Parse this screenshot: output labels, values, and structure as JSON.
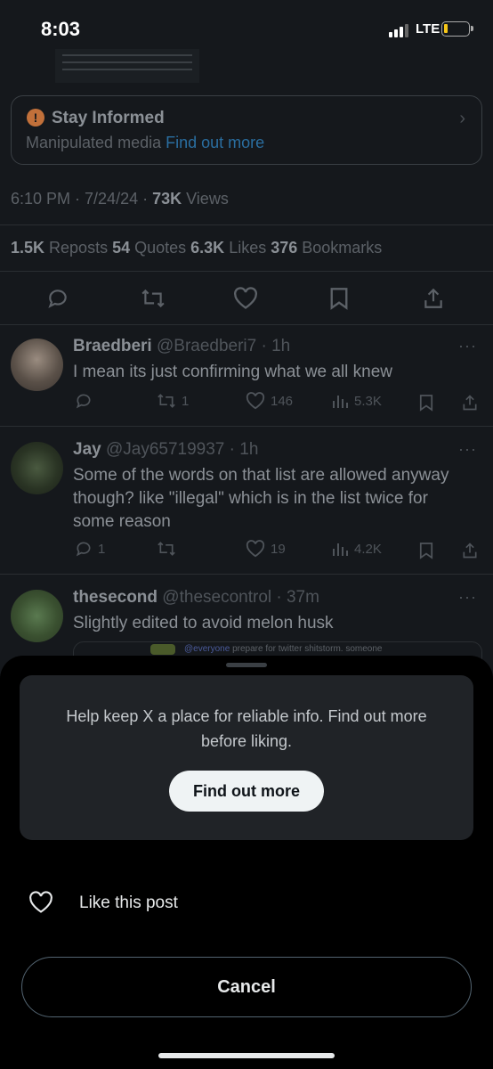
{
  "status_bar": {
    "time": "8:03",
    "network": "LTE",
    "signal_bars": 4,
    "signal_bars_filled": 3,
    "battery_level": 0.1
  },
  "note_box": {
    "title": "Stay Informed",
    "subtitle": "Manipulated media",
    "link": "Find out more",
    "warn_glyph": "!",
    "chevron_glyph": "›"
  },
  "post_meta": {
    "time_date": "6:10 PM · 7/24/24 · ",
    "views_count": "73K",
    "views_label": " Views"
  },
  "post_stats": {
    "reposts_count": "1.5K",
    "reposts_label": " Reposts  ",
    "quotes_count": "54",
    "quotes_label": " Quotes  ",
    "likes_count": "6.3K",
    "likes_label": " Likes  ",
    "bookmarks_count": "376",
    "bookmarks_label": " Bookmarks"
  },
  "replies": [
    {
      "name": "Braedberi",
      "handle_time": " @Braedberi7 · 1h",
      "text": "I mean its just confirming what we all knew",
      "replies": "",
      "reposts": "1",
      "likes": "146",
      "views": "5.3K"
    },
    {
      "name": "Jay",
      "handle_time": " @Jay65719937 · 1h",
      "text": "Some of the words on that list are allowed anyway though? like \"illegal\" which is in the list twice for some reason",
      "replies": "1",
      "reposts": "",
      "likes": "19",
      "views": "4.2K"
    },
    {
      "name": "thesecond",
      "handle_time": " @thesecontrol · 37m",
      "text": "Slightly edited to avoid melon husk",
      "quote_mention": "@everyone",
      "quote_text": " prepare for twitter shitstorm. someone"
    }
  ],
  "more_glyph": "···",
  "sheet": {
    "message": "Help keep X a place for reliable info. Find out more before liking.",
    "find_button": "Find out more",
    "like_label": "Like this post",
    "cancel_button": "Cancel"
  },
  "colors": {
    "link": "#1d9bf0",
    "warning": "#c1703a",
    "background": "#000000"
  }
}
